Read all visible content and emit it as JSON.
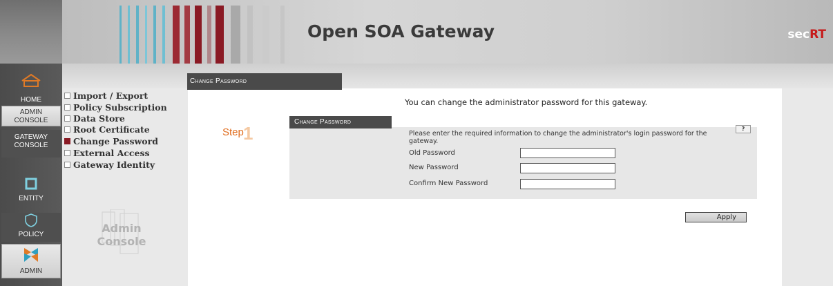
{
  "header": {
    "title": "Open SOA Gateway",
    "brand_prefix": "sec",
    "brand_suffix": "RT",
    "brand_accent_color": "#c61a1a"
  },
  "nav": [
    {
      "label": "HOME",
      "icon": "home-icon"
    },
    {
      "label": "ADMIN\nCONSOLE",
      "icon": ""
    },
    {
      "label": "GATEWAY\nCONSOLE",
      "icon": ""
    },
    {
      "label": "ENTITY",
      "icon": "entity-icon"
    },
    {
      "label": "POLICY",
      "icon": "shield-icon"
    },
    {
      "label": "ADMIN",
      "icon": "admin-icon"
    }
  ],
  "menu": {
    "items": [
      {
        "label": "Import / Export",
        "active": false
      },
      {
        "label": "Policy Subscription",
        "active": false
      },
      {
        "label": "Data Store",
        "active": false
      },
      {
        "label": "Root Certificate",
        "active": false
      },
      {
        "label": "Change Password",
        "active": true
      },
      {
        "label": "External Access",
        "active": false
      },
      {
        "label": "Gateway Identity",
        "active": false
      }
    ],
    "logo_line1": "Admin",
    "logo_line2": "Console",
    "active_color": "#8a1a24"
  },
  "main": {
    "tab_title": "Change Password",
    "intro": "You can change the administrator password for this gateway.",
    "step_label": "Step",
    "step_number": "1",
    "form": {
      "tab_title": "Change Password",
      "description": "Please enter the required information to change the administrator's login password for the gateway.",
      "help_label": "?",
      "fields": [
        {
          "label": "Old Password",
          "value": ""
        },
        {
          "label": "New Password",
          "value": ""
        },
        {
          "label": "Confirm New Password",
          "value": ""
        }
      ]
    },
    "apply_label": "Apply"
  }
}
